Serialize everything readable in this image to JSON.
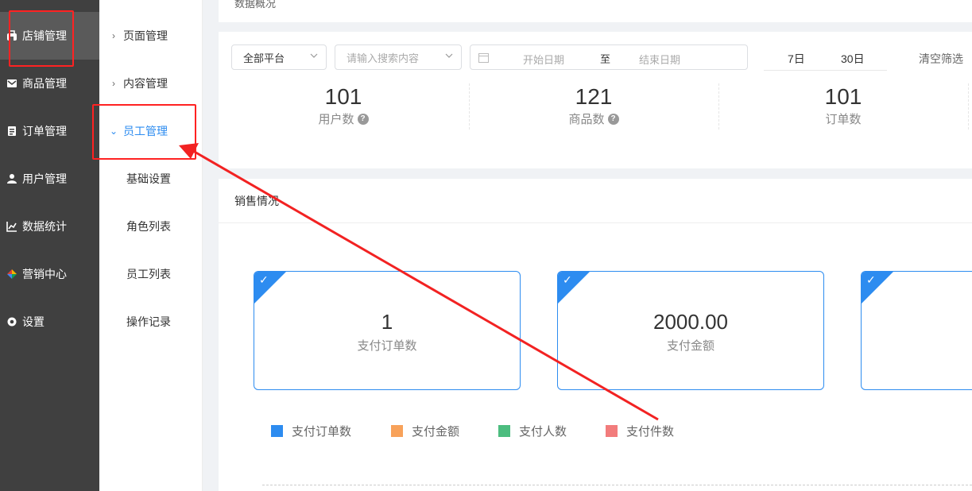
{
  "sidebar": {
    "items": [
      {
        "label": "店铺管理",
        "icon": "store-icon"
      },
      {
        "label": "商品管理",
        "icon": "mail-icon"
      },
      {
        "label": "订单管理",
        "icon": "order-icon"
      },
      {
        "label": "用户管理",
        "icon": "user-icon"
      },
      {
        "label": "数据统计",
        "icon": "chart-icon"
      },
      {
        "label": "营销中心",
        "icon": "marketing-icon"
      },
      {
        "label": "设置",
        "icon": "gear-icon"
      }
    ]
  },
  "submenu": {
    "items": [
      {
        "label": "页面管理"
      },
      {
        "label": "内容管理"
      },
      {
        "label": "员工管理"
      }
    ],
    "children": [
      {
        "label": "基础设置"
      },
      {
        "label": "角色列表"
      },
      {
        "label": "员工列表"
      },
      {
        "label": "操作记录"
      }
    ]
  },
  "overview": {
    "title": "数据概况"
  },
  "filters": {
    "platform": "全部平台",
    "search_placeholder": "请输入搜索内容",
    "start_date": "开始日期",
    "separator": "至",
    "end_date": "结束日期",
    "quick_7": "7日",
    "quick_30": "30日",
    "clear": "清空筛选"
  },
  "stats": [
    {
      "value": "101",
      "label": "用户数"
    },
    {
      "value": "121",
      "label": "商品数"
    },
    {
      "value": "101",
      "label": "订单数"
    }
  ],
  "sales": {
    "title": "销售情况",
    "cards": [
      {
        "value": "1",
        "label": "支付订单数"
      },
      {
        "value": "2000.00",
        "label": "支付金额"
      }
    ],
    "legend": [
      {
        "label": "支付订单数",
        "color": "#2d8cf0"
      },
      {
        "label": "支付金额",
        "color": "#f8a25a"
      },
      {
        "label": "支付人数",
        "color": "#4cbd7f"
      },
      {
        "label": "支付件数",
        "color": "#f27c7c"
      }
    ]
  },
  "colors": {
    "accent": "#2d8cf0",
    "annotation": "#f22222"
  }
}
